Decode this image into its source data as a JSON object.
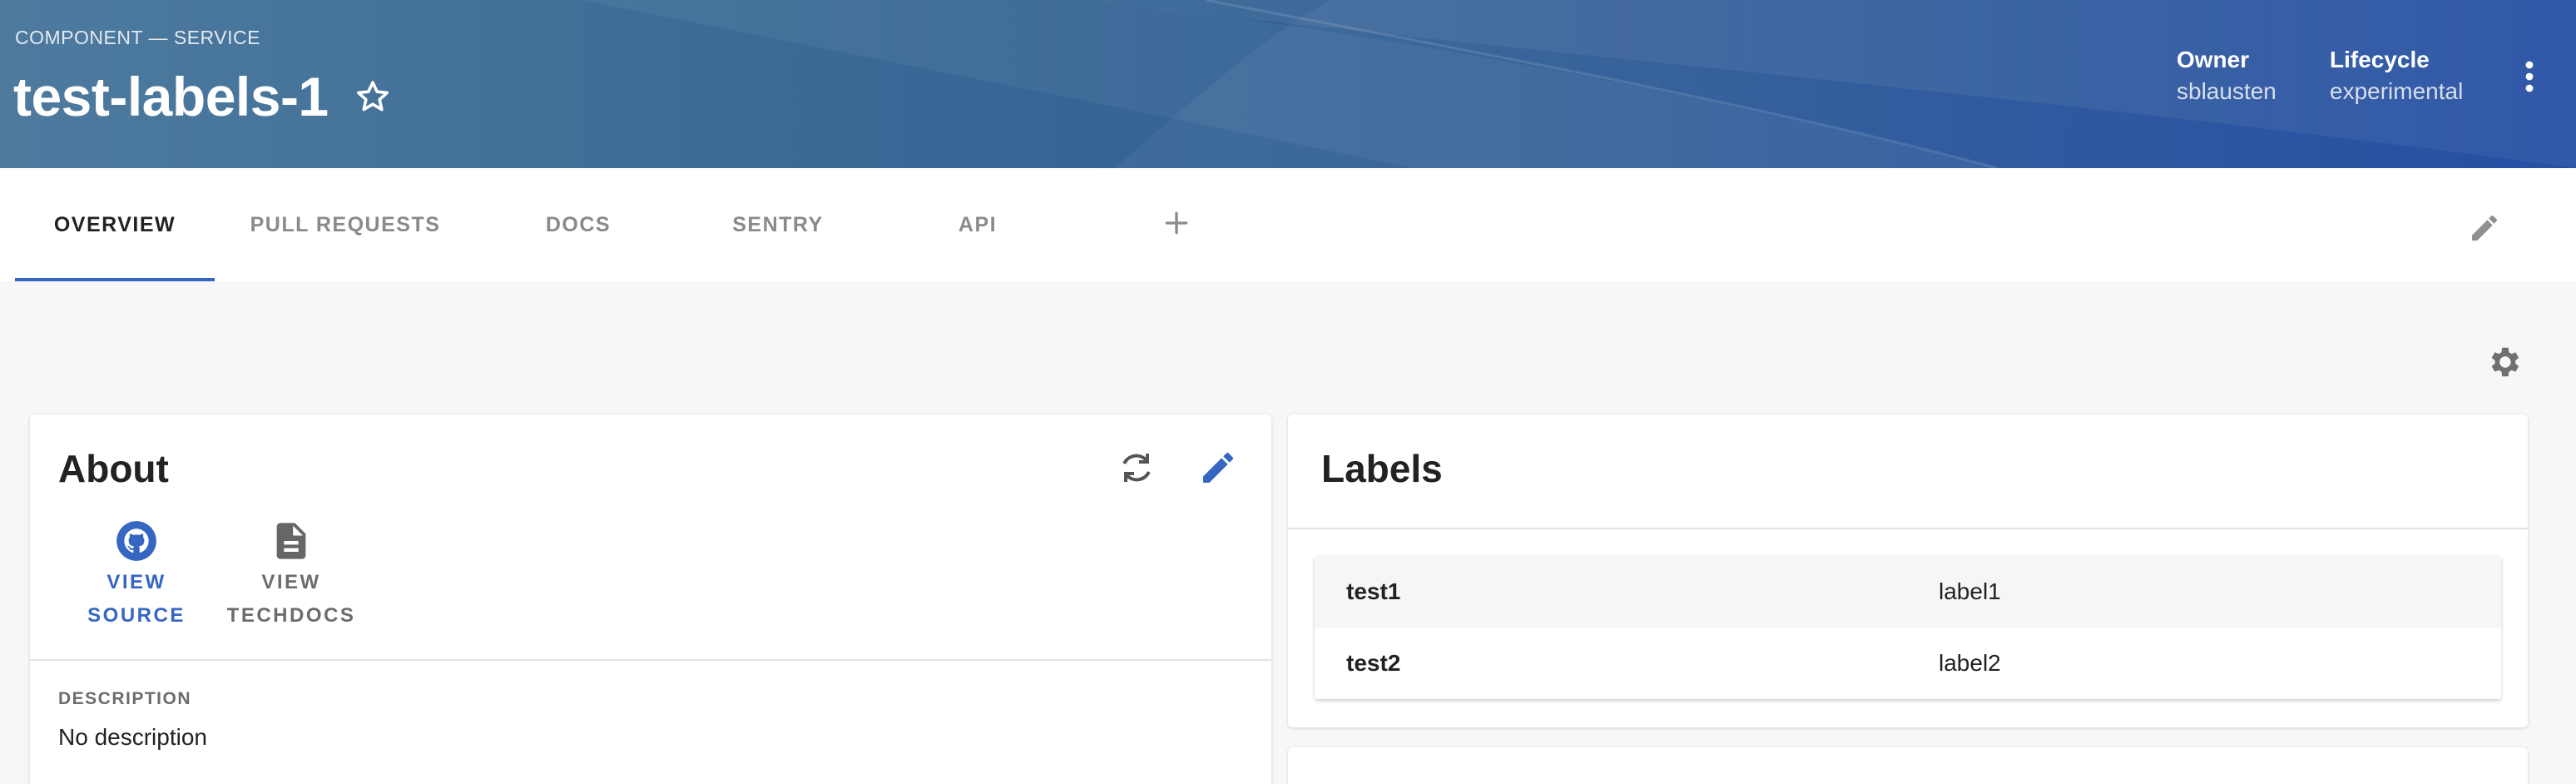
{
  "header": {
    "eyebrow": "COMPONENT — SERVICE",
    "title": "test-labels-1",
    "owner_label": "Owner",
    "owner_value": "sblausten",
    "lifecycle_label": "Lifecycle",
    "lifecycle_value": "experimental",
    "icons": {
      "favorite": "star-outline-icon",
      "menu": "more-vert-icon"
    }
  },
  "tabs": [
    "OVERVIEW",
    "PULL REQUESTS",
    "DOCS",
    "SENTRY",
    "API"
  ],
  "active_tab": "OVERVIEW",
  "about": {
    "title": "About",
    "view_source_line1": "VIEW",
    "view_source_line2": "SOURCE",
    "view_techdocs_line1": "VIEW",
    "view_techdocs_line2": "TECHDOCS",
    "description_label": "DESCRIPTION",
    "description_value": "No description"
  },
  "labels_card": {
    "title": "Labels",
    "rows": [
      {
        "key": "test1",
        "value": "label1"
      },
      {
        "key": "test2",
        "value": "label2"
      }
    ]
  },
  "colors": {
    "accent": "#3466c2",
    "header_start": "#4e7a9e",
    "header_end": "#1a46a0",
    "background": "#f7f7f7"
  }
}
